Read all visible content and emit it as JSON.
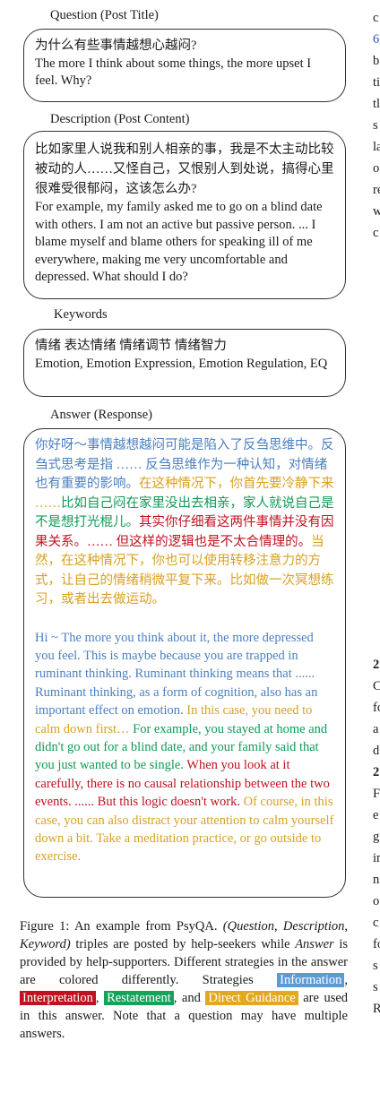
{
  "labels": {
    "question": "Question (Post Title)",
    "description": "Description (Post Content)",
    "keywords": "Keywords",
    "answer": "Answer (Response)"
  },
  "question": {
    "cn": "为什么有些事情越想心越闷?",
    "en": "The more I think about some things, the more upset I feel. Why?"
  },
  "description": {
    "cn": "比如家里人说我和别人相亲的事，我是不太主动比较被动的人……又怪自己，又恨别人到处说，搞得心里很难受很郁闷，这该怎么办?",
    "en": "For example, my family asked me to go on a blind date with others. I am not an active but passive person. ... I blame myself and blame others for speaking ill of me everywhere, making me very uncomfortable and depressed. What should I do?"
  },
  "keywords": {
    "cn": "情绪 表达情绪 情绪调节 情绪智力",
    "en": "Emotion, Emotion Expression, Emotion Regulation, EQ"
  },
  "answer": {
    "cn": [
      {
        "strategy": "info",
        "text": "你好呀～事情越想越闷可能是陷入了反刍思维中。反刍式思考是指 …… 反刍思维作为一种认知，对情绪也有重要的影响。"
      },
      {
        "strategy": "guide",
        "text": "在这种情况下，你首先要冷静下来 ……"
      },
      {
        "strategy": "restate",
        "text": "比如自己闷在家里没出去相亲，家人就说自己是不是想打光棍儿。"
      },
      {
        "strategy": "interp",
        "text": "其实你仔细看这两件事情并没有因果关系。…… 但这样的逻辑也是不太合情理的。"
      },
      {
        "strategy": "guide",
        "text": "当然，在这种情况下，你也可以使用转移注意力的方式，让自己的情绪稍微平复下来。比如做一次冥想练习，或者出去做运动。"
      }
    ],
    "en": [
      {
        "strategy": "info",
        "text": "Hi ~ The more you think about it, the more depressed you feel. This is maybe because you are trapped in ruminant thinking. Ruminant thinking means that ...... Ruminant thinking, as a form of cognition, also has an important effect on emotion."
      },
      {
        "strategy": "guide",
        "text": "In this case, you need to calm down first…"
      },
      {
        "strategy": "restate",
        "text": "For example, you stayed at home and didn't go out for a blind date, and your family said that you just wanted to be single."
      },
      {
        "strategy": "interp",
        "text": "When you look at it carefully, there is no causal relationship between the two events. ...... But this logic doesn't work."
      },
      {
        "strategy": "guide",
        "text": "Of course, in this case, you can also distract your attention to calm yourself down a bit. Take a meditation practice, or go outside to exercise."
      }
    ]
  },
  "caption": {
    "prefix": "Figure 1: An example from PsyQA.",
    "triple": "(Question, Description, Keyword)",
    "mid1": "triples are posted by help-seekers while",
    "answer_word": "Answer",
    "mid2": "is provided by help-supporters. Different strategies in the answer are colored differently. Strategies",
    "tag_info": "Information",
    "tag_interp": "Interpretation",
    "tag_restate": "Restatement",
    "and": ", and",
    "tag_guide": "Direct Guidance",
    "suffix": "are used in this answer. Note that a question may have multiple answers."
  },
  "right_column": {
    "lines": [
      "c",
      "6",
      "b",
      "ti",
      "tl",
      "s",
      "la",
      "o",
      "re",
      "w",
      "c"
    ],
    "lower_lines": [
      "2",
      "C",
      "fo",
      "a",
      "d",
      "2",
      "F",
      "e",
      "g",
      "in",
      "n",
      "o",
      "c",
      "fo",
      "s",
      "s",
      "R"
    ]
  },
  "colors": {
    "information": "#5b9bd5",
    "interpretation": "#c0111f",
    "restatement": "#15a35c",
    "direct_guidance": "#e0a91f"
  }
}
